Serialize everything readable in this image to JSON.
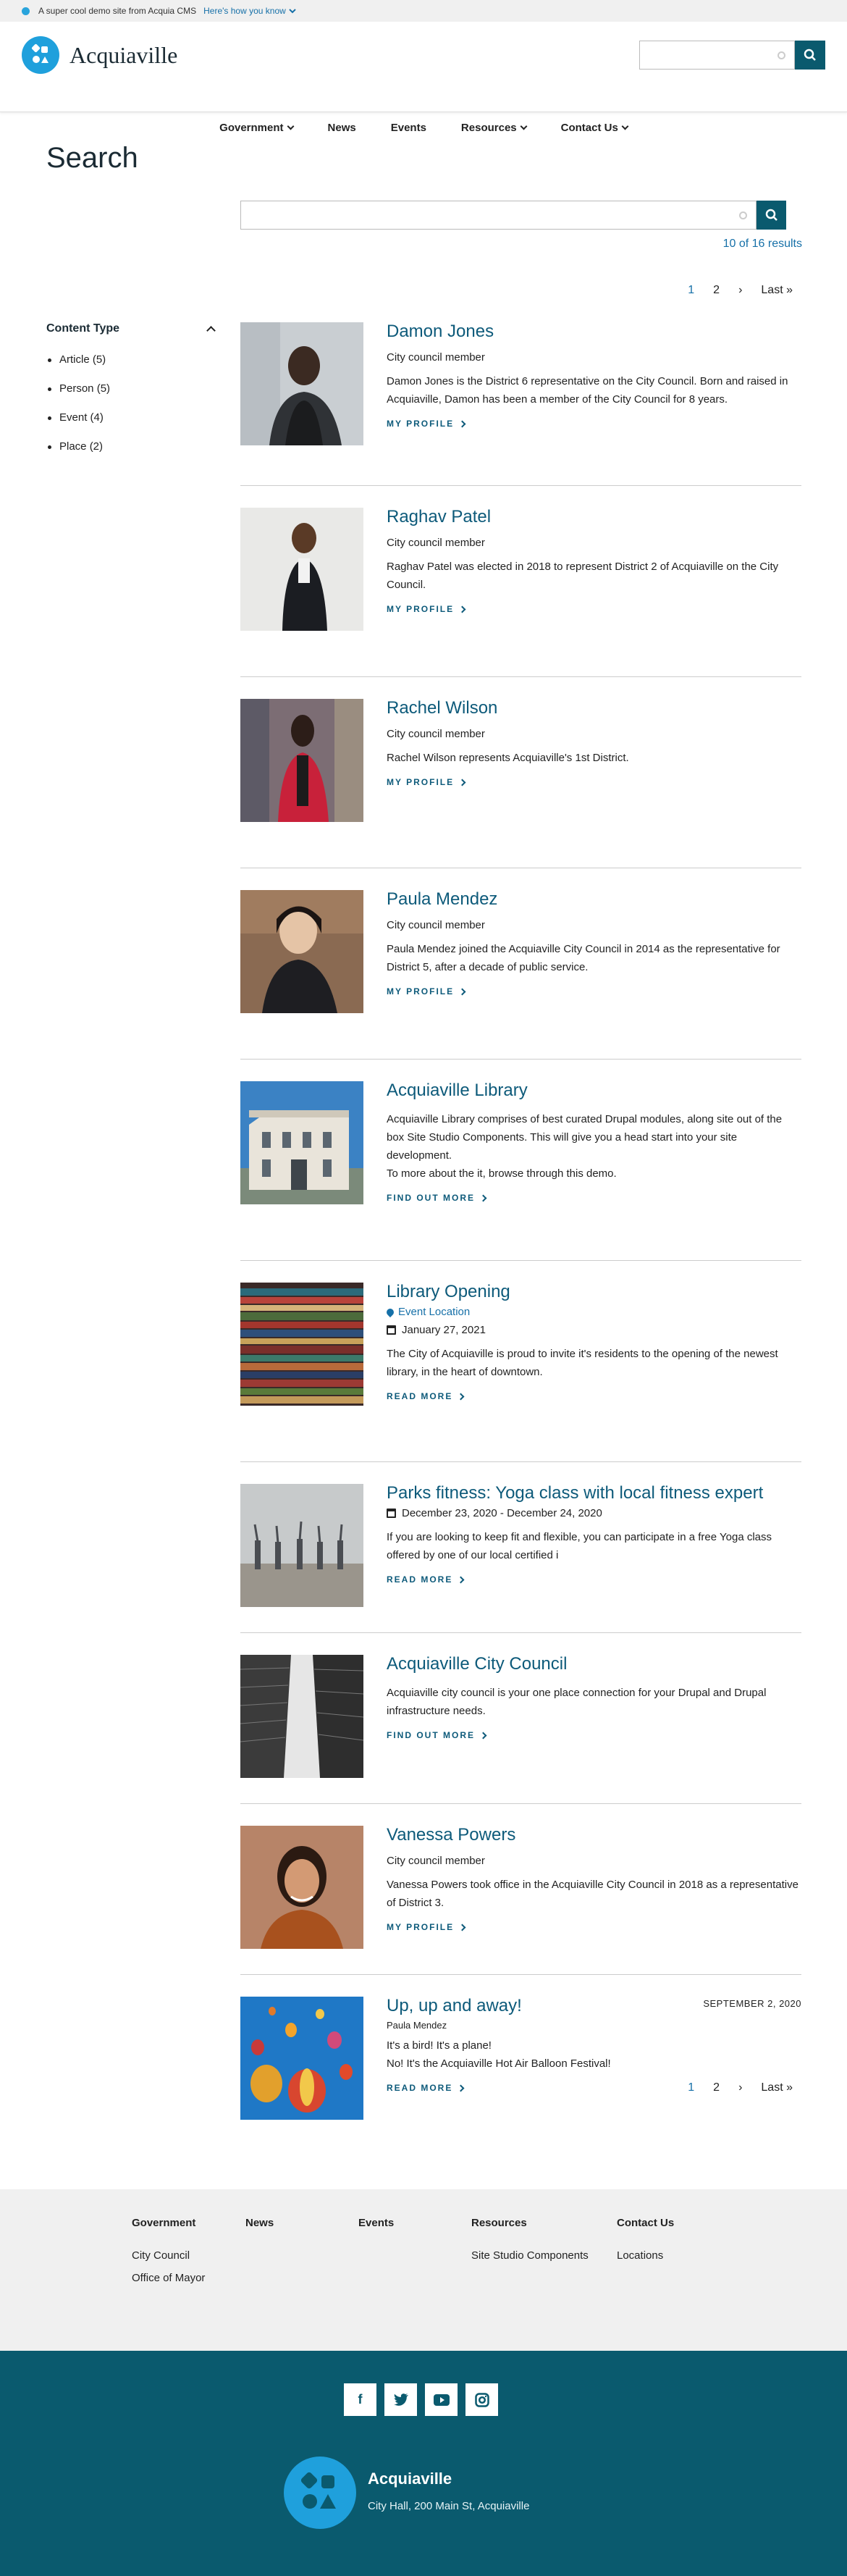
{
  "banner": {
    "text": "A super cool demo site from Acquia CMS",
    "link": "Here's how you know"
  },
  "site": {
    "name": "Acquiaville"
  },
  "nav": [
    {
      "label": "Government",
      "dropdown": true
    },
    {
      "label": "News",
      "dropdown": false
    },
    {
      "label": "Events",
      "dropdown": false
    },
    {
      "label": "Resources",
      "dropdown": true
    },
    {
      "label": "Contact Us",
      "dropdown": true
    }
  ],
  "page": {
    "title": "Search"
  },
  "search": {
    "value": "",
    "results_count": "10 of 16 results"
  },
  "pager": {
    "pages": [
      "1",
      "2"
    ],
    "next": "›",
    "last": "Last »"
  },
  "facet": {
    "title": "Content Type",
    "items": [
      "Article (5)",
      "Person (5)",
      "Event (4)",
      "Place (2)"
    ]
  },
  "results": [
    {
      "title": "Damon Jones",
      "subtitle": "City council member",
      "description": "Damon Jones is the District 6 representative on the City Council. Born and raised in Acquiaville, Damon has been a member of the City Council for 8 years.",
      "link": "MY PROFILE"
    },
    {
      "title": "Raghav Patel",
      "subtitle": "City council member",
      "description": "Raghav Patel was elected in 2018 to represent District 2 of Acquiaville on the City Council.",
      "link": "MY PROFILE"
    },
    {
      "title": "Rachel Wilson",
      "subtitle": "City council member",
      "description": "Rachel Wilson represents Acquiaville's 1st District.",
      "link": "MY PROFILE"
    },
    {
      "title": "Paula Mendez",
      "subtitle": "City council member",
      "description": "Paula Mendez joined the Acquiaville City Council in 2014 as the representative for District 5, after a decade of public service.",
      "link": "MY PROFILE"
    },
    {
      "title": "Acquiaville Library",
      "description": "Acquiaville Library comprises of best curated Drupal modules, along site out of the box Site Studio Components. This will give you a head start into your site development.",
      "description2": "To more about the it, browse through this demo.",
      "link": "FIND OUT MORE"
    },
    {
      "title": "Library Opening",
      "location": "Event Location",
      "date": "January 27, 2021",
      "description": "The City of Acquiaville is proud to invite it's residents to the opening of the newest library, in the heart of downtown.",
      "link": "READ MORE"
    },
    {
      "title": "Parks fitness: Yoga class with local fitness expert",
      "date": "December 23, 2020 - December 24, 2020",
      "description": "If you are looking to keep fit and flexible, you can participate in a free Yoga class offered by one of our local certified i",
      "link": "READ MORE"
    },
    {
      "title": "Acquiaville City Council",
      "description": "Acquiaville city council is your one place connection for your Drupal and Drupal infrastructure needs.",
      "link": "FIND OUT MORE"
    },
    {
      "title": "Vanessa Powers",
      "subtitle": "City council member",
      "description": "Vanessa Powers took office in the Acquiaville City Council in 2018 as a representative of District 3.",
      "link": "MY PROFILE"
    },
    {
      "title": "Up, up and away!",
      "right_date": "SEPTEMBER 2, 2020",
      "author": "Paula Mendez",
      "description": "It's a bird! It's a plane!",
      "description2": "No! It's the Acquiaville Hot Air Balloon Festival!",
      "link": "READ MORE"
    }
  ],
  "footer": {
    "columns": [
      {
        "heading": "Government",
        "links": [
          "City Council",
          "Office of Mayor"
        ]
      },
      {
        "heading": "News",
        "links": []
      },
      {
        "heading": "Events",
        "links": []
      },
      {
        "heading": "Resources",
        "links": [
          "Site Studio Components"
        ]
      },
      {
        "heading": "Contact Us",
        "links": [
          "Locations"
        ]
      }
    ],
    "social": [
      "facebook-icon",
      "twitter-icon",
      "youtube-icon",
      "instagram-icon"
    ],
    "site_name": "Acquiaville",
    "address": "City Hall, 200 Main St, Acquiaville"
  },
  "colors": {
    "primary": "#0a5a6e",
    "link": "#1670a8",
    "brand": "#1fa0dc",
    "title": "#0d5a7a"
  }
}
